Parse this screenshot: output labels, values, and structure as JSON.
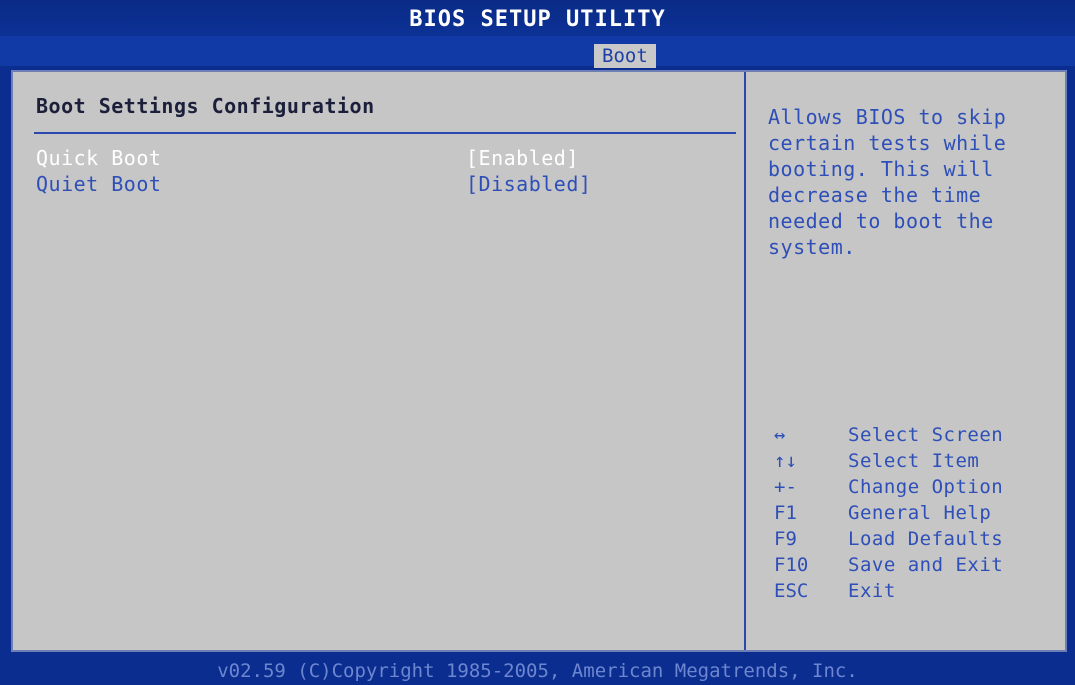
{
  "window": {
    "title": "BIOS SETUP UTILITY"
  },
  "menu": {
    "active_tab": "Boot"
  },
  "section": {
    "title": "Boot Settings Configuration"
  },
  "settings": [
    {
      "label": "Quick Boot",
      "value": "[Enabled]",
      "selected": true
    },
    {
      "label": "Quiet Boot",
      "value": "[Disabled]",
      "selected": false
    }
  ],
  "help": {
    "text": "Allows BIOS to skip\ncertain tests while\nbooting. This will\ndecrease the time\nneeded to boot the\nsystem."
  },
  "keys": [
    {
      "key": "↔",
      "description": "Select Screen"
    },
    {
      "key": "↑↓",
      "description": "Select Item"
    },
    {
      "key": "+-",
      "description": "Change Option"
    },
    {
      "key": "F1",
      "description": "General Help"
    },
    {
      "key": "F9",
      "description": "Load Defaults"
    },
    {
      "key": "F10",
      "description": "Save and Exit"
    },
    {
      "key": "ESC",
      "description": "Exit"
    }
  ],
  "footer": {
    "text": "v02.59 (C)Copyright 1985-2005, American Megatrends, Inc."
  },
  "colors": {
    "background": "#0b2d8f",
    "panel": "#c6c6c6",
    "label": "#2e4fb8",
    "highlight": "#ffffff"
  }
}
